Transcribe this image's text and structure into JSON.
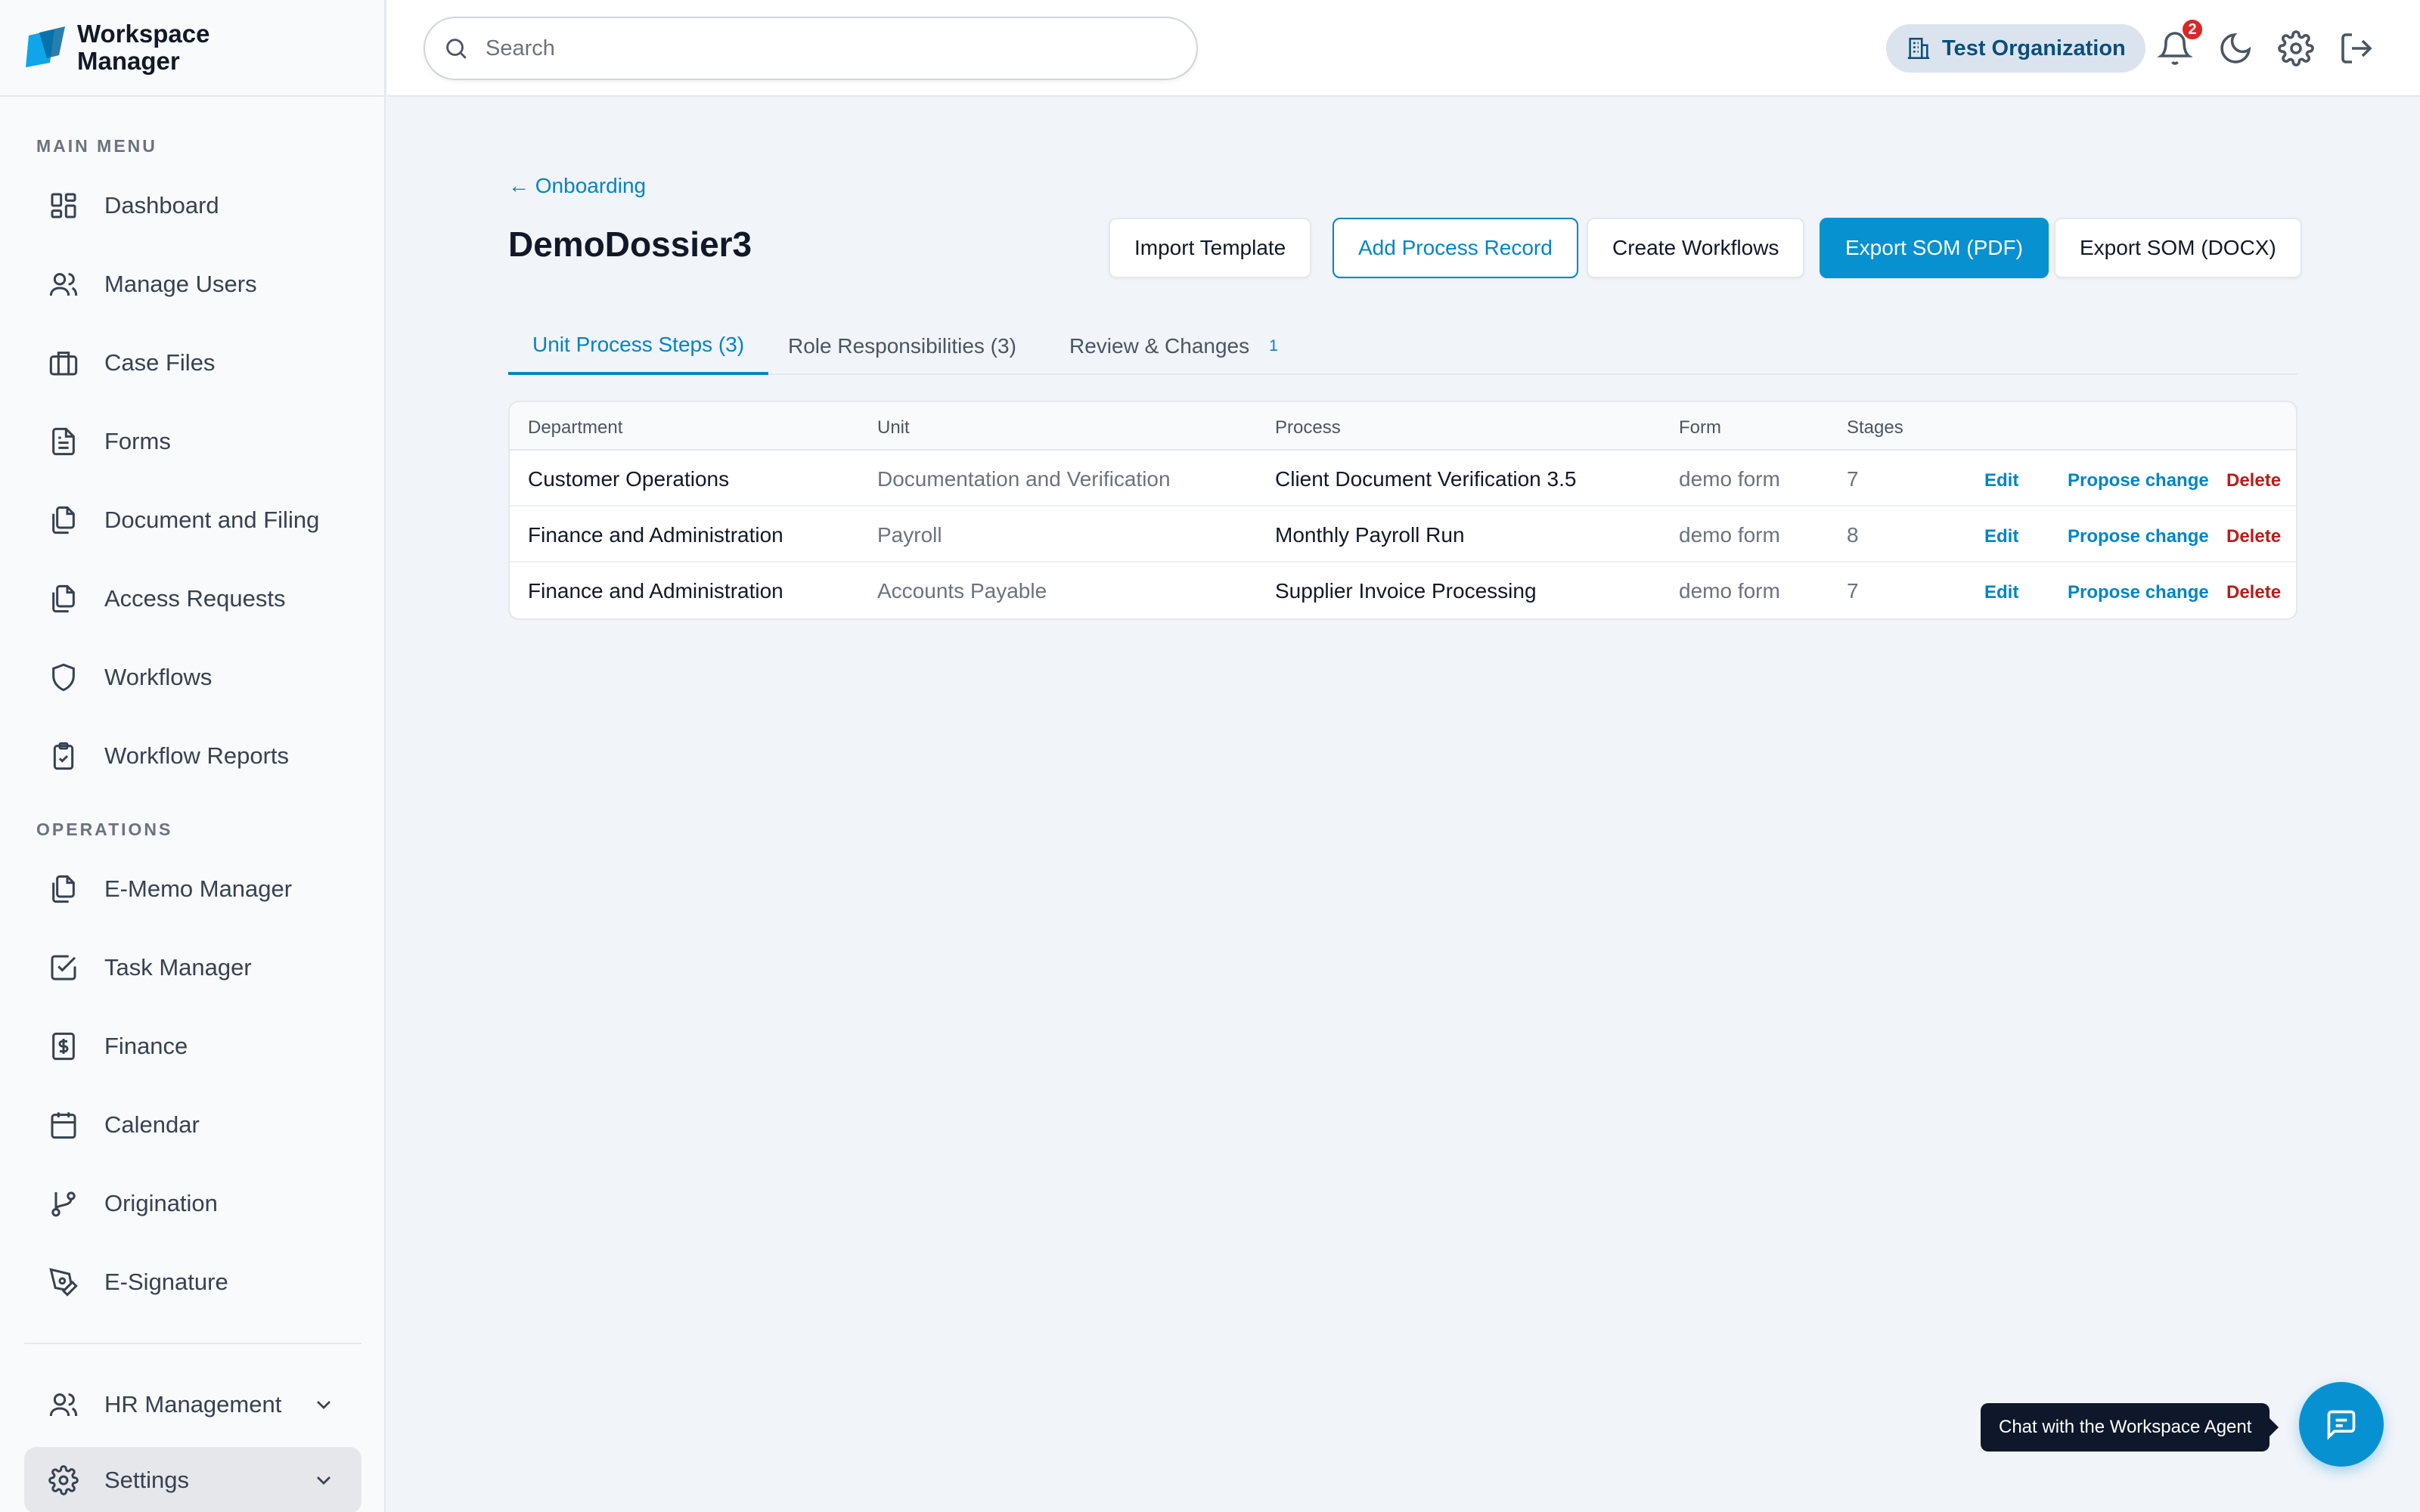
{
  "brand": {
    "name_line1": "Workspace",
    "name_line2": "Manager"
  },
  "sidebar": {
    "main_menu_label": "MAIN MENU",
    "operations_label": "OPERATIONS",
    "main_items": [
      {
        "label": "Dashboard",
        "icon": "dashboard-grid-icon"
      },
      {
        "label": "Manage Users",
        "icon": "users-icon"
      },
      {
        "label": "Case Files",
        "icon": "briefcase-icon"
      },
      {
        "label": "Forms",
        "icon": "file-text-icon"
      },
      {
        "label": "Document and Filing",
        "icon": "files-icon"
      },
      {
        "label": "Access Requests",
        "icon": "files-icon"
      },
      {
        "label": "Workflows",
        "icon": "shield-icon"
      },
      {
        "label": "Workflow Reports",
        "icon": "clipboard-check-icon"
      }
    ],
    "operations_items": [
      {
        "label": "E-Memo Manager",
        "icon": "files-icon"
      },
      {
        "label": "Task Manager",
        "icon": "checkbox-icon"
      },
      {
        "label": "Finance",
        "icon": "dollar-receipt-icon"
      },
      {
        "label": "Calendar",
        "icon": "calendar-icon"
      },
      {
        "label": "Origination",
        "icon": "git-branch-icon"
      },
      {
        "label": "E-Signature",
        "icon": "pen-tool-icon"
      }
    ],
    "bottom_items": [
      {
        "label": "HR Management",
        "icon": "users-icon"
      },
      {
        "label": "Settings",
        "icon": "gear-icon"
      }
    ]
  },
  "topbar": {
    "search_placeholder": "Search",
    "organization": "Test Organization",
    "notification_count": "2"
  },
  "page": {
    "back_link": "← Onboarding",
    "title": "DemoDossier3",
    "buttons": {
      "import_template": "Import Template",
      "add_process_record": "Add Process Record",
      "create_workflows": "Create Workflows",
      "export_pdf": "Export SOM (PDF)",
      "export_docx": "Export SOM (DOCX)"
    },
    "tabs": [
      {
        "label": "Unit Process Steps (3)",
        "count": ""
      },
      {
        "label": "Role Responsibilities (3)",
        "count": ""
      },
      {
        "label": "Review & Changes",
        "count": "1"
      }
    ]
  },
  "table": {
    "headers": [
      "Department",
      "Unit",
      "Process",
      "Form",
      "Stages"
    ],
    "actions": {
      "edit": "Edit",
      "propose": "Propose change",
      "delete": "Delete"
    },
    "rows": [
      [
        "Customer Operations",
        "Documentation and Verification",
        "Client Document Verification 3.5",
        "demo form",
        "7"
      ],
      [
        "Finance and Administration",
        "Payroll",
        "Monthly Payroll Run",
        "demo form",
        "8"
      ],
      [
        "Finance and Administration",
        "Accounts Payable",
        "Supplier Invoice Processing",
        "demo form",
        "7"
      ]
    ]
  },
  "chat": {
    "tooltip": "Chat with the Workspace Agent"
  },
  "colors": {
    "accent": "#0284c7",
    "primary_button": "#0891d1",
    "danger": "#b91c1c"
  }
}
